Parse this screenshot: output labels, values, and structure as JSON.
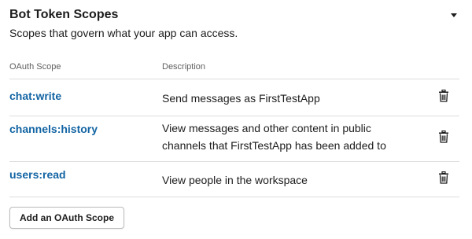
{
  "section": {
    "title": "Bot Token Scopes",
    "subtitle": "Scopes that govern what your app can access."
  },
  "table": {
    "headers": {
      "scope": "OAuth Scope",
      "description": "Description"
    },
    "rows": [
      {
        "scope": "chat:write",
        "description": "Send messages as FirstTestApp"
      },
      {
        "scope": "channels:history",
        "description_line1": "View messages and other content in public",
        "description_line2": "channels that FirstTestApp has been added to"
      },
      {
        "scope": "users:read",
        "description": "View people in the workspace"
      }
    ],
    "remove_icon": "trash-icon"
  },
  "actions": {
    "add_scope_label": "Add an OAuth Scope"
  },
  "colors": {
    "scope_link": "#1264a3",
    "text": "#1d1c1d",
    "muted": "#616061",
    "divider": "#dddddd"
  }
}
